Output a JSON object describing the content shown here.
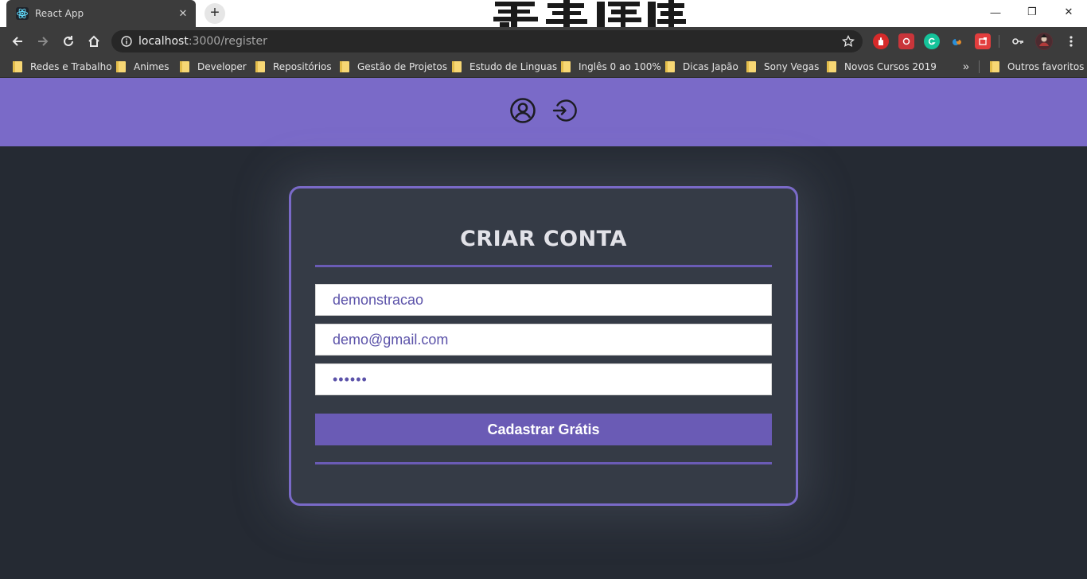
{
  "browser": {
    "tab_title": "React App",
    "tab_close": "✕",
    "new_tab": "+",
    "url_host": "localhost",
    "url_path": ":3000/register",
    "window_controls": {
      "minimize": "—",
      "restore": "❐",
      "close": "✕"
    },
    "bookmarks": [
      {
        "label": "Redes e Trabalho"
      },
      {
        "label": "Animes"
      },
      {
        "label": "Developer"
      },
      {
        "label": "Repositórios"
      },
      {
        "label": "Gestão de Projetos"
      },
      {
        "label": "Estudo de Linguas"
      },
      {
        "label": "Inglês 0 ao 100%"
      },
      {
        "label": "Dicas Japão"
      },
      {
        "label": "Sony Vegas"
      },
      {
        "label": "Novos Cursos 2019"
      }
    ],
    "bookmarks_more": "»",
    "other_bookmarks": "Outros favoritos",
    "extensions": [
      "adblock-icon",
      "photo-extension-icon",
      "grammarly-icon",
      "colorpick-icon",
      "screenshot-icon",
      "key-icon",
      "profile-avatar"
    ]
  },
  "app": {
    "header": {
      "color": "#7a6ac8",
      "icons": [
        "user-circle-icon",
        "sign-in-icon"
      ]
    },
    "register_form": {
      "title": "CRIAR CONTA",
      "name_value": "demonstracao",
      "email_value": "demo@gmail.com",
      "password_value": "••••••",
      "submit_label": "Cadastrar Grátis",
      "accent": "#6a5bb5"
    }
  }
}
